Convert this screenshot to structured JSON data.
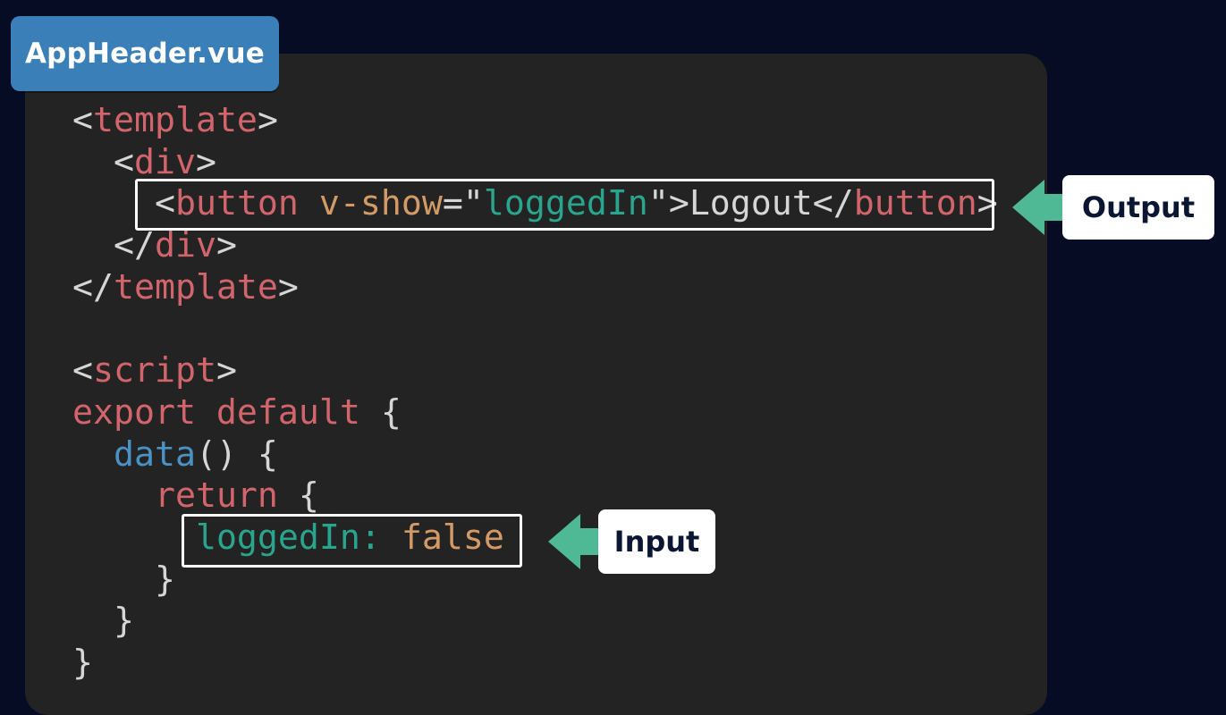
{
  "file_tab": {
    "label": "AppHeader.vue"
  },
  "code": {
    "line1": {
      "open": "<",
      "tag": "template",
      "close": ">"
    },
    "line2": {
      "indent": "  ",
      "open": "<",
      "tag": "div",
      "close": ">"
    },
    "line3": {
      "indent": "    ",
      "open": "<",
      "tag": "button",
      "space": " ",
      "attr": "v-show",
      "eq": "=",
      "quote_open": "\"",
      "attr_value": "loggedIn",
      "quote_close": "\"",
      "gt": ">",
      "text": "Logout",
      "close_open": "</",
      "close_tag": "button",
      "close_gt": ">"
    },
    "line4": {
      "indent": "  ",
      "open": "</",
      "tag": "div",
      "close": ">"
    },
    "line5": {
      "open": "</",
      "tag": "template",
      "close": ">"
    },
    "line7": {
      "open": "<",
      "tag": "script",
      "close": ">"
    },
    "line8": {
      "kw": "export default",
      "brace": " {"
    },
    "line9": {
      "indent": "  ",
      "fn": "data",
      "rest": "() {"
    },
    "line10": {
      "indent": "    ",
      "kw": "return",
      "brace": " {"
    },
    "line11": {
      "indent": "      ",
      "prop": "loggedIn:",
      "space": " ",
      "val": "false"
    },
    "line12": {
      "indent": "    ",
      "brace": "}"
    },
    "line13": {
      "indent": "  ",
      "brace": "}"
    },
    "line14": {
      "brace": "}"
    }
  },
  "callouts": {
    "output": {
      "label": "Output"
    },
    "input": {
      "label": "Input"
    }
  },
  "colors": {
    "background": "#050c24",
    "panel": "#232323",
    "tab": "#3a7fb7",
    "tag": "#d2656c",
    "attr": "#d49a66",
    "string": "#2aa58d",
    "function": "#4a92c4",
    "arrow": "#4fb894"
  },
  "icons": {
    "arrow": "left-arrow-icon"
  }
}
